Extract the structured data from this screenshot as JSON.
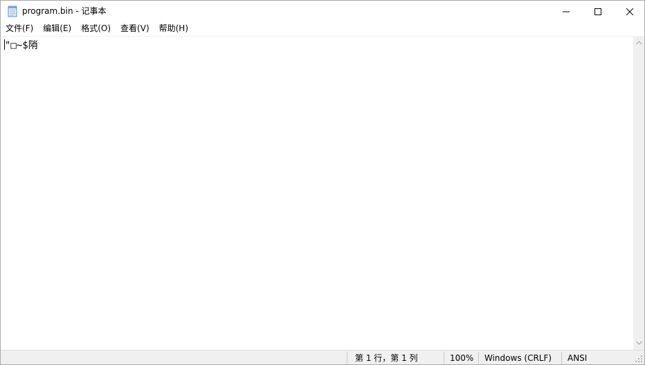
{
  "window": {
    "title": "program.bin - 记事本",
    "icon": "notepad-icon",
    "controls": {
      "minimize_icon": "minimize-icon",
      "maximize_icon": "maximize-icon",
      "close_icon": "close-icon"
    }
  },
  "menu": {
    "items": [
      {
        "label": "文件(F)"
      },
      {
        "label": "编辑(E)"
      },
      {
        "label": "格式(O)"
      },
      {
        "label": "查看(V)"
      },
      {
        "label": "帮助(H)"
      }
    ]
  },
  "editor": {
    "content": "\"□~$陗"
  },
  "statusbar": {
    "position": "第 1 行，第 1 列",
    "zoom": "100%",
    "line_ending": "Windows (CRLF)",
    "encoding": "ANSI"
  },
  "colors": {
    "status_bg": "#f0f0f0",
    "scrollbar_bg": "#f0f0f0"
  }
}
